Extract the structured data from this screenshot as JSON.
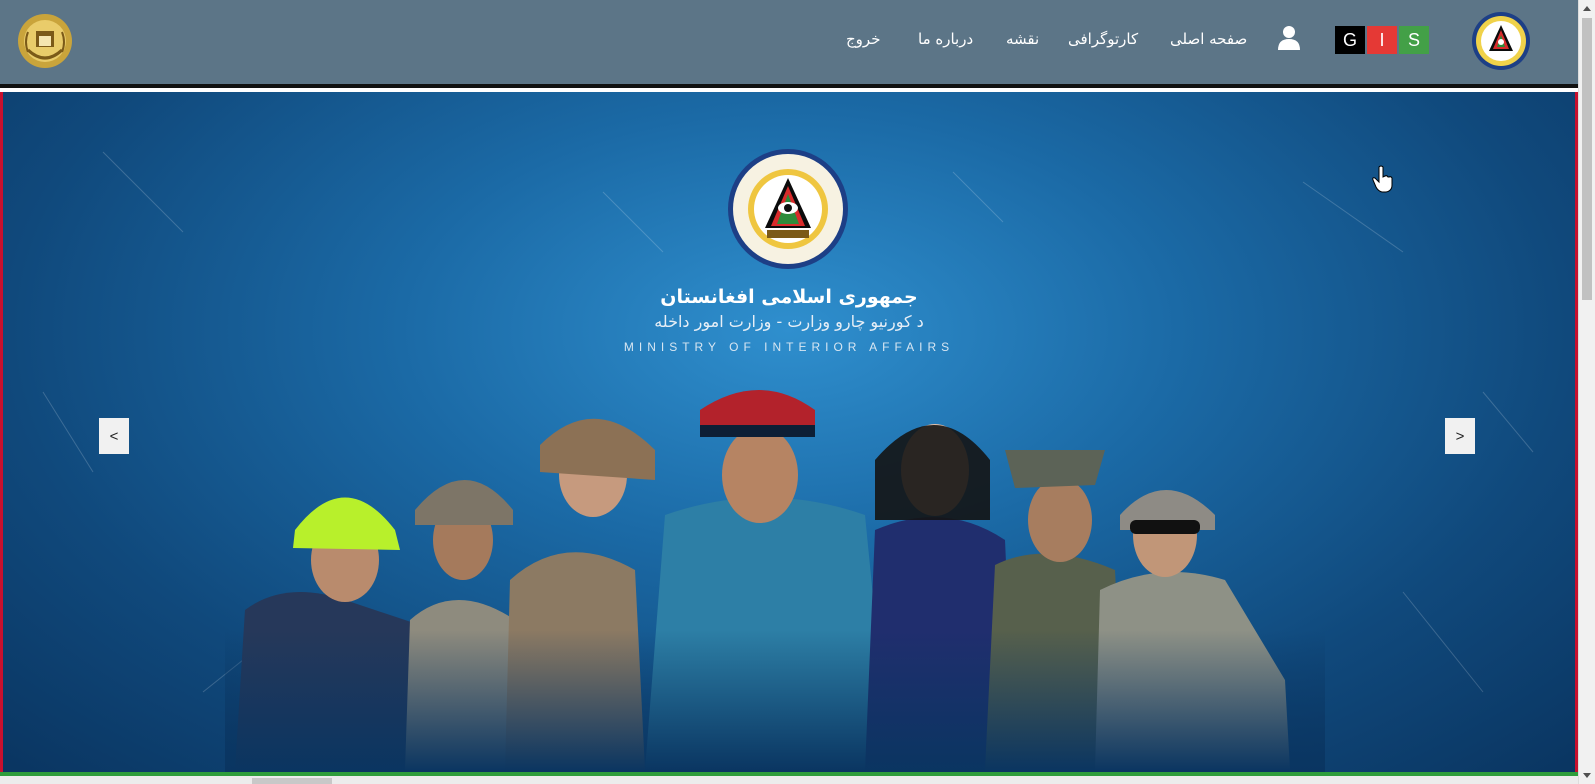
{
  "header": {
    "nav_items": [
      {
        "label": "صفحه اصلی"
      },
      {
        "label": "کارتوگرافی"
      },
      {
        "label": "نقشه"
      },
      {
        "label": "درباره ما"
      },
      {
        "label": "خروج"
      }
    ],
    "gis_badge": {
      "g": "G",
      "i": "I",
      "s": "S"
    },
    "icons": {
      "user": "user-icon",
      "left_emblem": "national-emblem-icon",
      "right_emblem": "police-seal-icon"
    }
  },
  "hero": {
    "title": "جمهوری اسلامی افغانستان",
    "subtitle": "د کورنیو چارو وزارت   -   وزارت امور داخله",
    "english": "MINISTRY OF INTERIOR AFFAIRS",
    "prev_label": "<",
    "next_label": ">"
  },
  "colors": {
    "header_bg": "#5c7587",
    "hero_blue": "#1b6aa6",
    "accent_red": "#c8102e",
    "accent_green": "#2e9d3b"
  }
}
